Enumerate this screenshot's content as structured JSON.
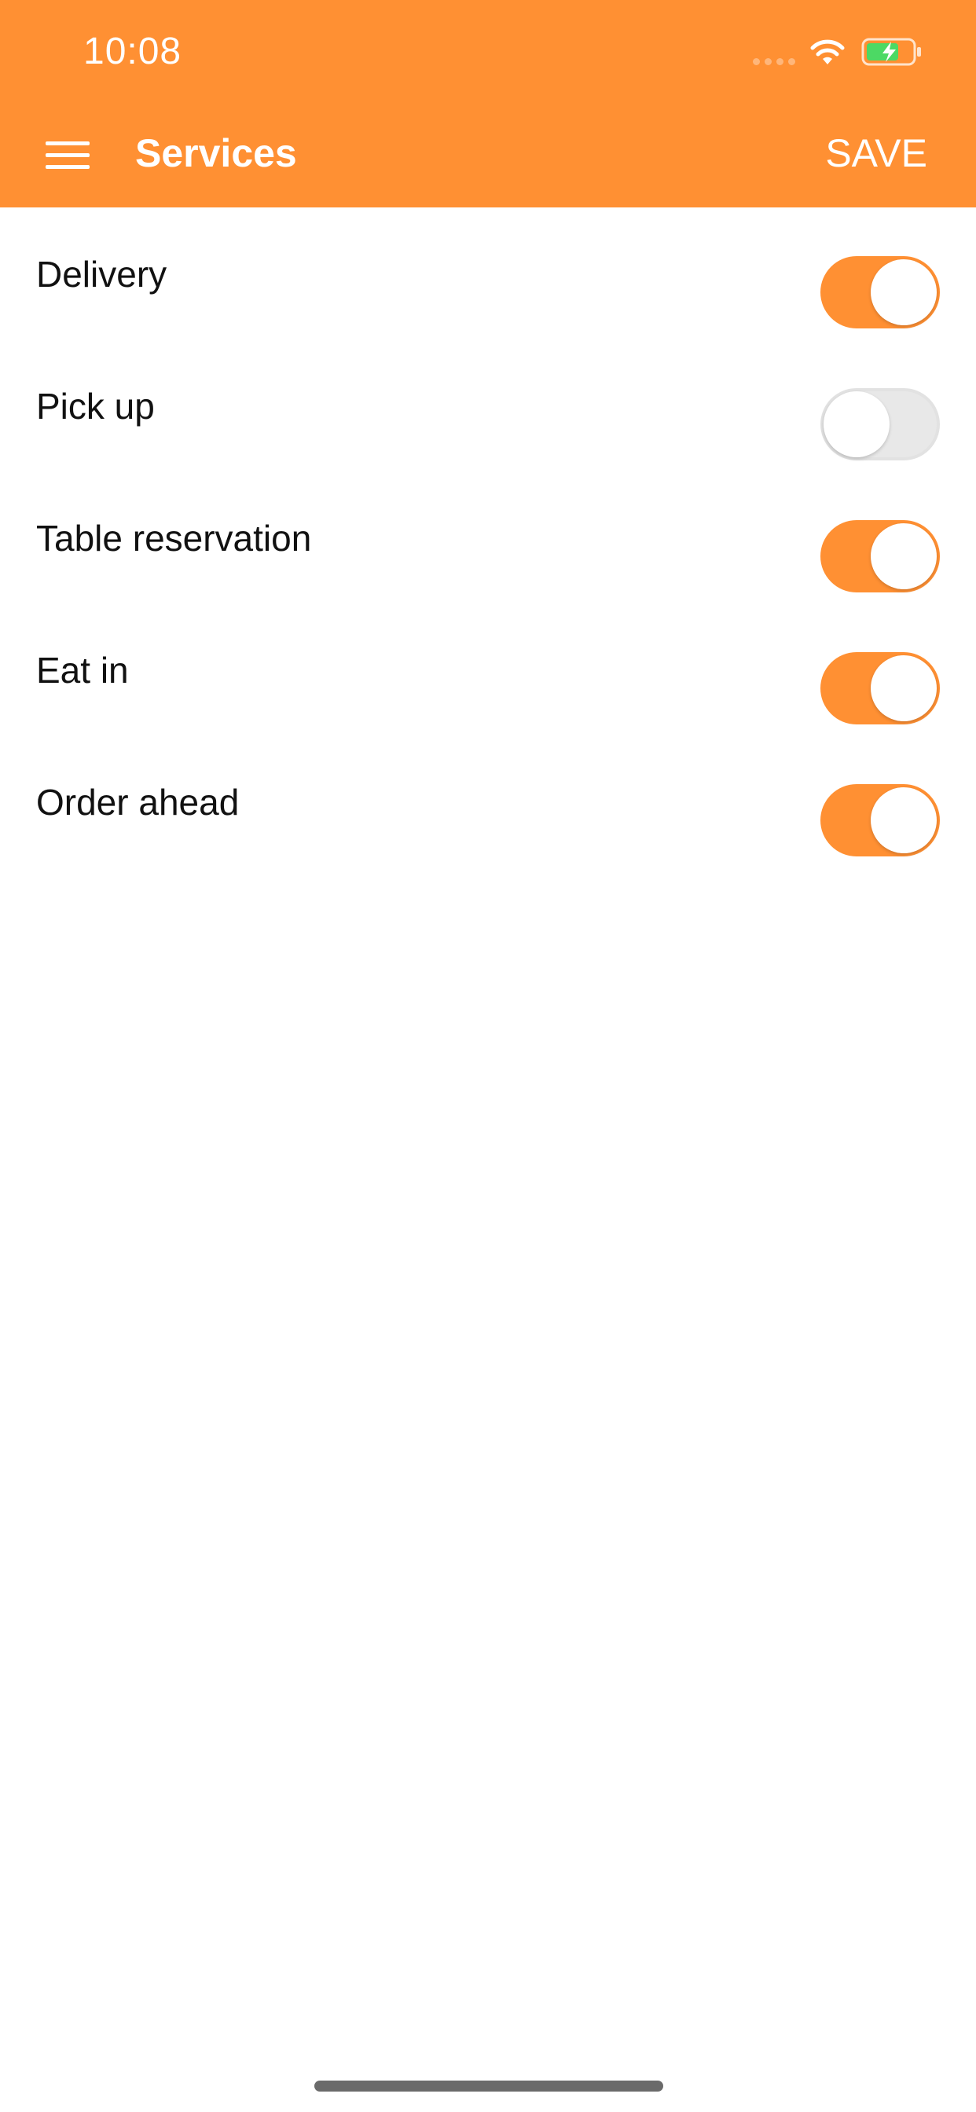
{
  "status_bar": {
    "time": "10:08"
  },
  "header": {
    "title": "Services",
    "save_label": "SAVE",
    "background_color": "#FF9033"
  },
  "services": [
    {
      "label": "Delivery",
      "enabled": true
    },
    {
      "label": "Pick up",
      "enabled": false
    },
    {
      "label": "Table reservation",
      "enabled": true
    },
    {
      "label": "Eat in",
      "enabled": true
    },
    {
      "label": "Order ahead",
      "enabled": true
    }
  ],
  "icons": {
    "menu": "menu-icon",
    "wifi": "wifi-icon",
    "battery": "battery-charging-icon"
  },
  "colors": {
    "accent": "#FF9033",
    "toggle_off": "#E8E8E8",
    "battery_fill": "#4CD964"
  }
}
